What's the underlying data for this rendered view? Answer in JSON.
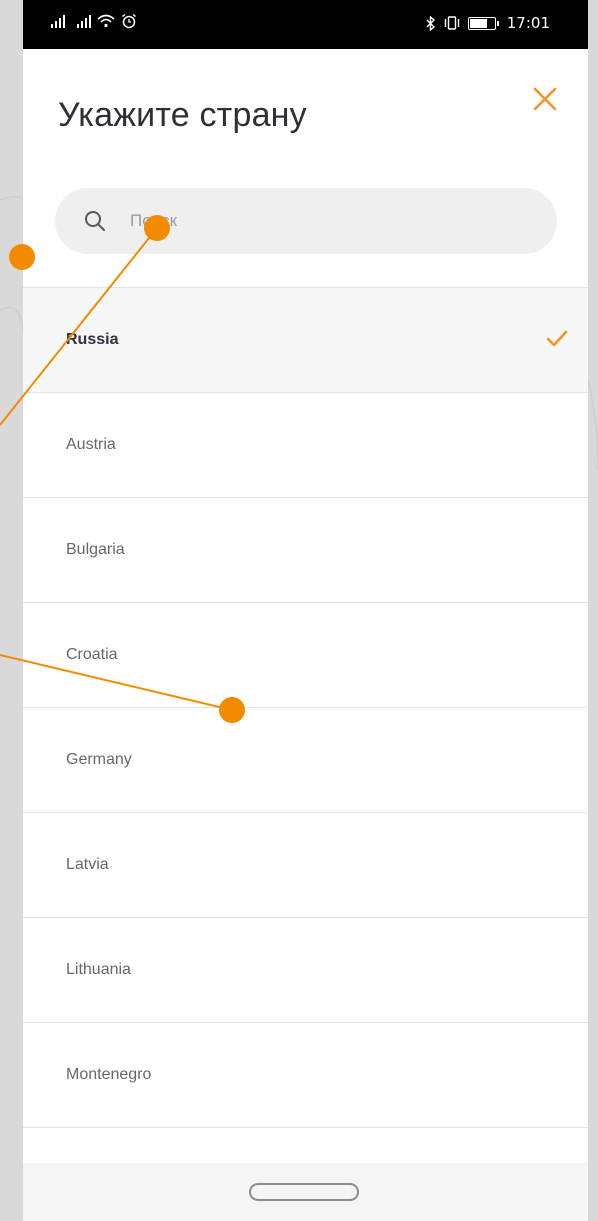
{
  "status_bar": {
    "time": "17:01"
  },
  "header": {
    "title": "Укажите страну",
    "close_icon": "close-icon"
  },
  "search": {
    "placeholder": "Поиск",
    "icon": "search-icon"
  },
  "countries": [
    {
      "name": "Russia",
      "selected": true
    },
    {
      "name": "Austria",
      "selected": false
    },
    {
      "name": "Bulgaria",
      "selected": false
    },
    {
      "name": "Croatia",
      "selected": false
    },
    {
      "name": "Germany",
      "selected": false
    },
    {
      "name": "Latvia",
      "selected": false
    },
    {
      "name": "Lithuania",
      "selected": false
    },
    {
      "name": "Montenegro",
      "selected": false
    }
  ],
  "colors": {
    "accent": "#f39523",
    "annotation": "#f38b00",
    "title": "#2f2f3a",
    "search_bg": "#efefef",
    "page_bg": "#d9d9d9"
  }
}
